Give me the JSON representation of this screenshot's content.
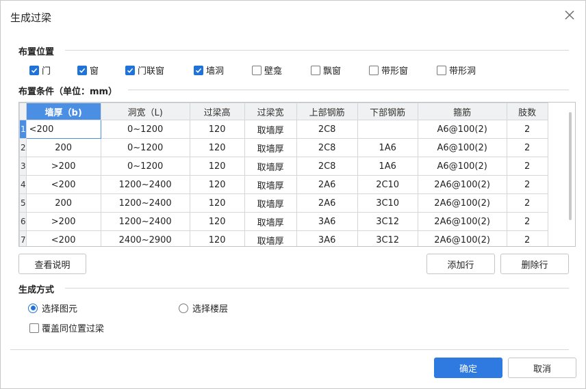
{
  "dialog": {
    "title": "生成过梁"
  },
  "placement": {
    "title": "布置位置",
    "options": [
      {
        "label": "门",
        "checked": true
      },
      {
        "label": "窗",
        "checked": true
      },
      {
        "label": "门联窗",
        "checked": true
      },
      {
        "label": "墙洞",
        "checked": true
      },
      {
        "label": "壁龛",
        "checked": false
      },
      {
        "label": "飘窗",
        "checked": false
      },
      {
        "label": "带形窗",
        "checked": false
      },
      {
        "label": "带形洞",
        "checked": false
      }
    ]
  },
  "conditions": {
    "title": "布置条件（单位：mm）",
    "columns": [
      "墙厚（b)",
      "洞宽（L)",
      "过梁高",
      "过梁宽",
      "上部钢筋",
      "下部钢筋",
      "箍筋",
      "肢数"
    ],
    "rows": [
      {
        "n": "1",
        "cells": [
          "<200",
          "0~1200",
          "120",
          "取墙厚",
          "2C8",
          "",
          "A6@100(2)",
          "2"
        ]
      },
      {
        "n": "2",
        "cells": [
          "200",
          "0~1200",
          "120",
          "取墙厚",
          "2C8",
          "1A6",
          "A6@100(2)",
          "2"
        ]
      },
      {
        "n": "3",
        "cells": [
          ">200",
          "0~1200",
          "120",
          "取墙厚",
          "2C8",
          "1A6",
          "A6@100(2)",
          "2"
        ]
      },
      {
        "n": "4",
        "cells": [
          "<200",
          "1200~2400",
          "120",
          "取墙厚",
          "2A6",
          "2C10",
          "2A6@100(2)",
          "2"
        ]
      },
      {
        "n": "5",
        "cells": [
          "200",
          "1200~2400",
          "120",
          "取墙厚",
          "2A6",
          "3C10",
          "2A6@100(2)",
          "2"
        ]
      },
      {
        "n": "6",
        "cells": [
          ">200",
          "1200~2400",
          "120",
          "取墙厚",
          "3A6",
          "3C12",
          "2A6@100(2)",
          "2"
        ]
      },
      {
        "n": "7",
        "cells": [
          "<200",
          "2400~2900",
          "120",
          "取墙厚",
          "3A6",
          "3C12",
          "2A6@100(2)",
          "2"
        ]
      }
    ]
  },
  "buttons": {
    "view_notes": "查看说明",
    "add_row": "添加行",
    "delete_row": "删除行",
    "ok": "确定",
    "cancel": "取消"
  },
  "generation": {
    "title": "生成方式",
    "options": [
      {
        "label": "选择图元",
        "selected": true
      },
      {
        "label": "选择楼层",
        "selected": false
      }
    ],
    "overwrite": {
      "label": "覆盖同位置过梁",
      "checked": false
    }
  },
  "colors": {
    "accent": "#2f7ae0",
    "header_active": "#4b8fe4"
  }
}
